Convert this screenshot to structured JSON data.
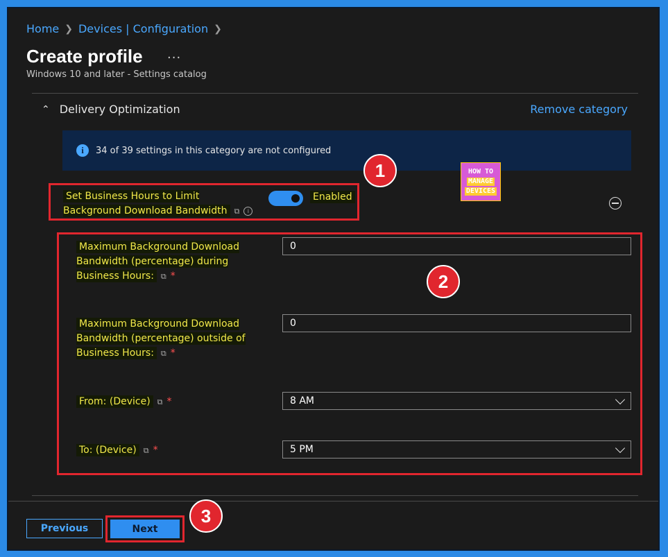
{
  "breadcrumb": {
    "home": "Home",
    "devices": "Devices | Configuration"
  },
  "page": {
    "title": "Create profile",
    "more": "...",
    "subtitle": "Windows 10 and later - Settings catalog"
  },
  "category": {
    "name": "Delivery Optimization",
    "remove_label": "Remove category"
  },
  "info": {
    "text": "34 of 39 settings in this category are not configured"
  },
  "setting": {
    "label": "Set Business Hours to Limit Background Download Bandwidth",
    "toggle_state": "Enabled"
  },
  "fields": {
    "max_during": {
      "label": "Maximum Background Download Bandwidth (percentage) during Business Hours:",
      "value": "0"
    },
    "max_outside": {
      "label": "Maximum Background Download Bandwidth (percentage) outside of Business Hours:",
      "value": "0"
    },
    "from": {
      "label": "From: (Device)",
      "value": "8 AM"
    },
    "to": {
      "label": "To: (Device)",
      "value": "5 PM"
    },
    "required_mark": "*"
  },
  "annotations": {
    "one": "1",
    "two": "2",
    "three": "3"
  },
  "logo": {
    "line1": "HOW TO",
    "line2": "MANAGE",
    "line3": "DEVICES"
  },
  "footer": {
    "previous": "Previous",
    "next": "Next"
  },
  "colors": {
    "accent": "#2f8ef0",
    "link": "#4aa8ff",
    "annotation_red": "#e1262e",
    "highlight_text": "#f2e94a"
  }
}
